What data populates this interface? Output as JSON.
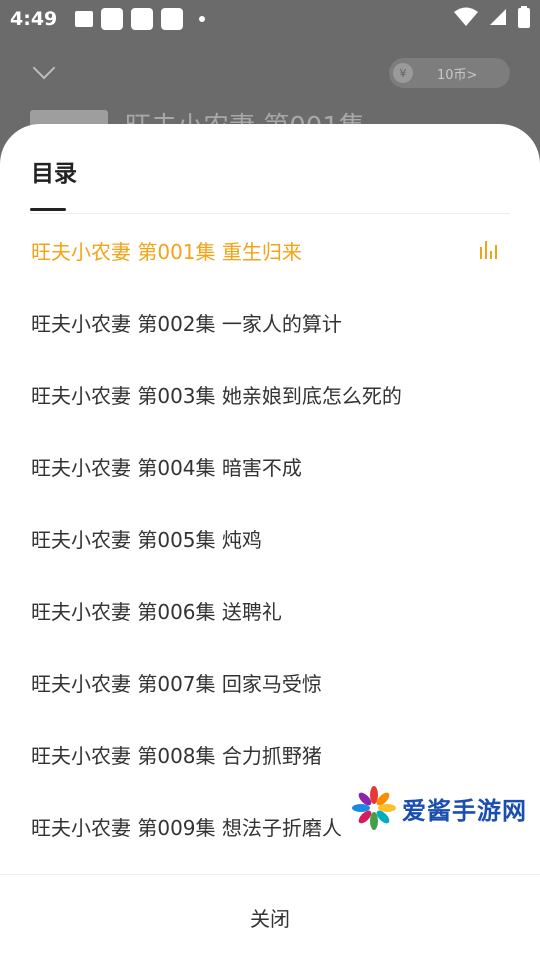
{
  "status": {
    "time": "4:49"
  },
  "background": {
    "title": "旺夫小农妻 第001集",
    "coin_label": "10币>",
    "coin_symbol": "¥"
  },
  "sheet": {
    "title": "目录",
    "episodes": [
      {
        "label": "旺夫小农妻 第001集 重生归来",
        "active": true
      },
      {
        "label": "旺夫小农妻 第002集 一家人的算计",
        "active": false
      },
      {
        "label": "旺夫小农妻 第003集 她亲娘到底怎么死的",
        "active": false
      },
      {
        "label": "旺夫小农妻 第004集 暗害不成",
        "active": false
      },
      {
        "label": "旺夫小农妻 第005集 炖鸡",
        "active": false
      },
      {
        "label": "旺夫小农妻 第006集 送聘礼",
        "active": false
      },
      {
        "label": "旺夫小农妻 第007集 回家马受惊",
        "active": false
      },
      {
        "label": "旺夫小农妻 第008集 合力抓野猪",
        "active": false
      },
      {
        "label": "旺夫小农妻 第009集 想法子折磨人",
        "active": false
      }
    ],
    "close_label": "关闭"
  },
  "watermark": {
    "text": "爱酱手游网"
  },
  "colors": {
    "accent": "#f5a315",
    "text": "#333333",
    "overlay": "#6b6b6b"
  }
}
